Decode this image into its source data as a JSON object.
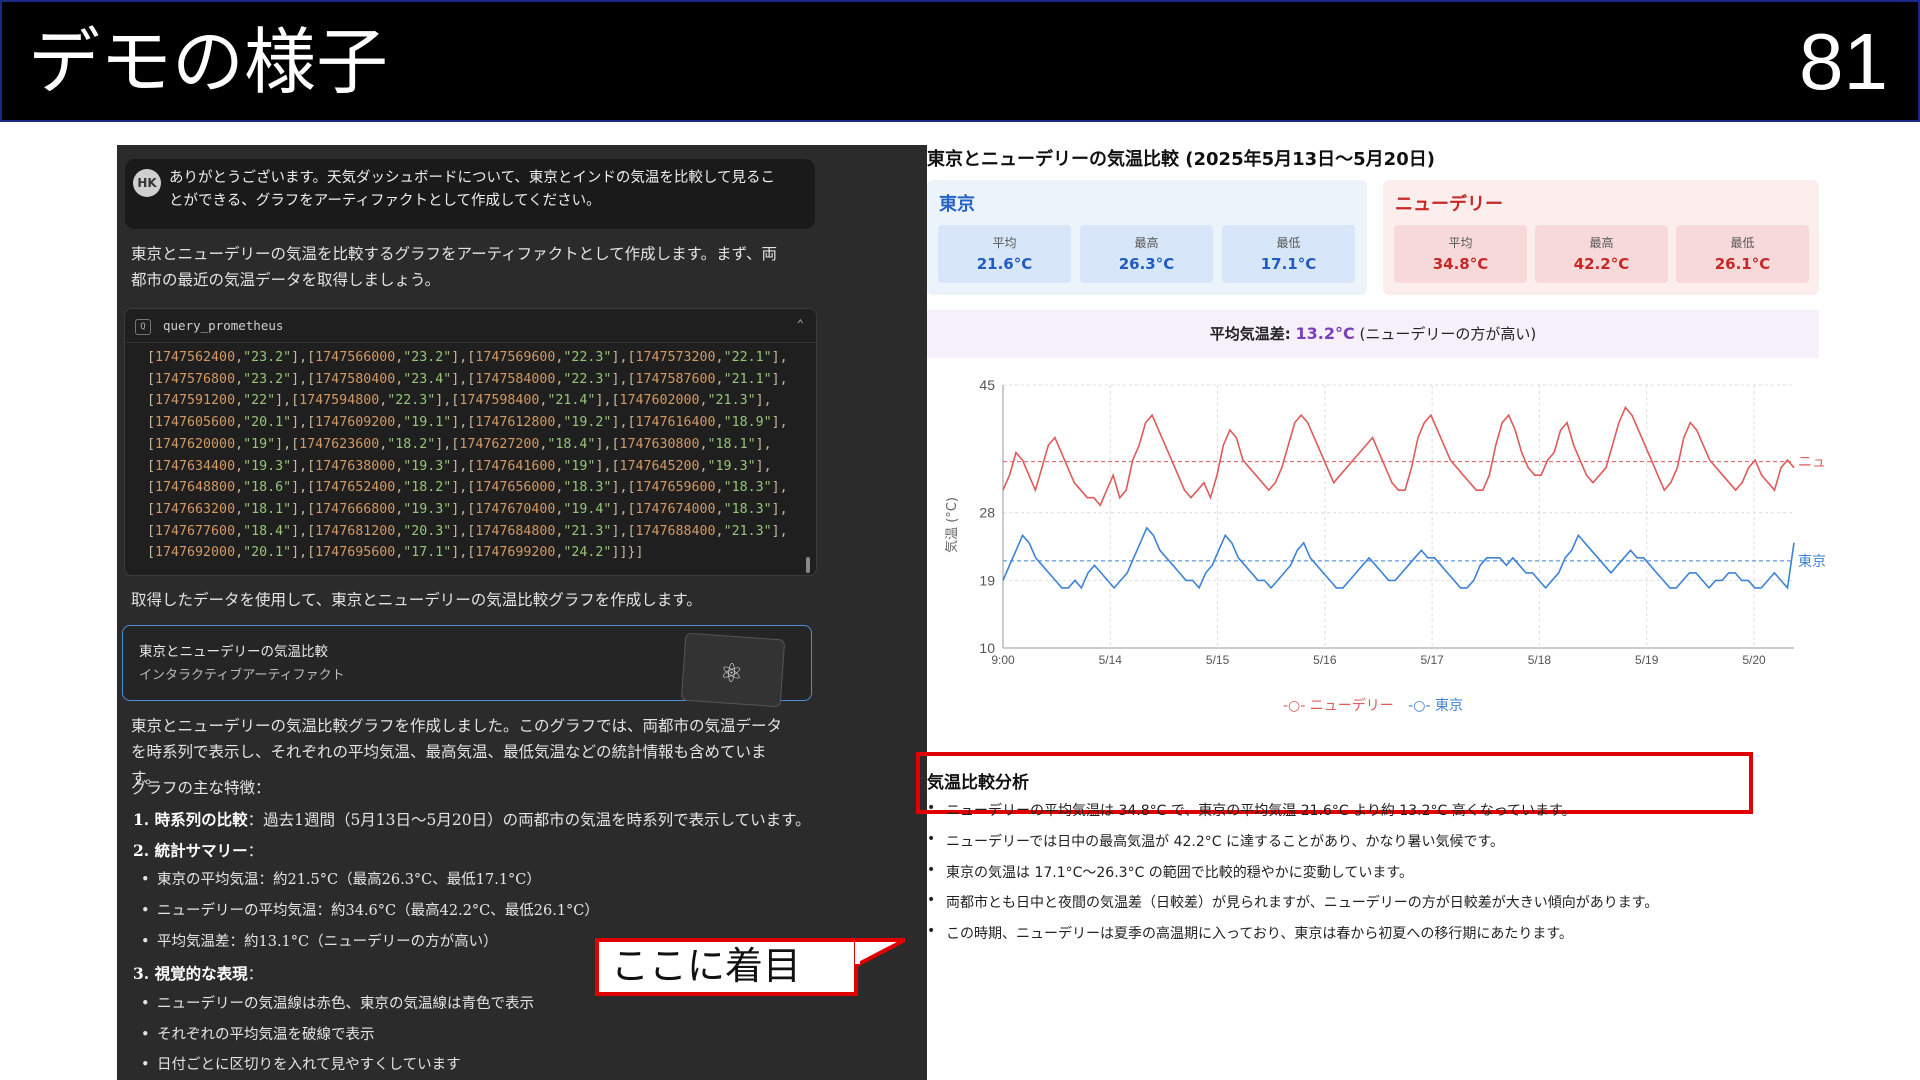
{
  "slide": {
    "title": "デモの様子",
    "page_number": "81"
  },
  "chat": {
    "user_avatar": "HK",
    "user_message": "ありがとうございます。天気ダッシュボードについて、東京とインドの気温を比較して見ることができる、グラフをアーティファクトとして作成してください。",
    "intro": "東京とニューデリーの気温を比較するグラフをアーティファクトとして作成します。まず、両都市の最近の気温データを取得しましょう。",
    "tool": {
      "name": "query_prometheus",
      "lines": [
        "[1747562400,\"23.2\"],[1747566000,\"23.2\"],[1747569600,\"22.3\"],[1747573200,\"22.1\"],",
        "[1747576800,\"23.2\"],[1747580400,\"23.4\"],[1747584000,\"22.3\"],[1747587600,\"21.1\"],",
        "[1747591200,\"22\"],[1747594800,\"22.3\"],[1747598400,\"21.4\"],[1747602000,\"21.3\"],",
        "[1747605600,\"20.1\"],[1747609200,\"19.1\"],[1747612800,\"19.2\"],[1747616400,\"18.9\"],",
        "[1747620000,\"19\"],[1747623600,\"18.2\"],[1747627200,\"18.4\"],[1747630800,\"18.1\"],",
        "[1747634400,\"19.3\"],[1747638000,\"19.3\"],[1747641600,\"19\"],[1747645200,\"19.3\"],",
        "[1747648800,\"18.6\"],[1747652400,\"18.2\"],[1747656000,\"18.3\"],[1747659600,\"18.3\"],",
        "[1747663200,\"18.1\"],[1747666800,\"19.3\"],[1747670400,\"19.4\"],[1747674000,\"18.3\"],",
        "[1747677600,\"18.4\"],[1747681200,\"20.3\"],[1747684800,\"21.3\"],[1747688400,\"21.3\"],",
        "[1747692000,\"20.1\"],[1747695600,\"17.1\"],[1747699200,\"24.2\"]]}]"
      ]
    },
    "after_tool": "取得したデータを使用して、東京とニューデリーの気温比較グラフを作成します。",
    "artifact": {
      "title": "東京とニューデリーの気温比較",
      "subtitle": "インタラクティブアーティファクト"
    },
    "summary": "東京とニューデリーの気温比較グラフを作成しました。このグラフでは、両都市の気温データを時系列で表示し、それぞれの平均気温、最高気温、最低気温などの統計情報も含めています。",
    "features_heading": "グラフの主な特徴：",
    "f1_label": "1. 時系列の比較",
    "f1_text": "：過去1週間（5月13日〜5月20日）の両都市の気温を時系列で表示しています。",
    "f2_label": "2. 統計サマリー",
    "f2_text": "：",
    "f2_items": [
      "東京の平均気温：約21.5°C（最高26.3°C、最低17.1°C）",
      "ニューデリーの平均気温：約34.6°C（最高42.2°C、最低26.1°C）",
      "平均気温差：約13.1°C（ニューデリーの方が高い）"
    ],
    "f3_label": "3. 視覚的な表現",
    "f3_text": "：",
    "f3_items": [
      "ニューデリーの気温線は赤色、東京の気温線は青色で表示",
      "それぞれの平均気温を破線で表示",
      "日付ごとに区切りを入れて見やすくしています"
    ]
  },
  "callout": "ここに着目",
  "dashboard": {
    "title": "東京とニューデリーの気温比較 (2025年5月13日〜5月20日)",
    "tokyo": {
      "name": "東京",
      "avg_label": "平均",
      "avg": "21.6°C",
      "max_label": "最高",
      "max": "26.3°C",
      "min_label": "最低",
      "min": "17.1°C"
    },
    "delhi": {
      "name": "ニューデリー",
      "avg_label": "平均",
      "avg": "34.8°C",
      "max_label": "最高",
      "max": "42.2°C",
      "min_label": "最低",
      "min": "26.1°C"
    },
    "diff_label": "平均気温差:",
    "diff_value": "13.2°C",
    "diff_note": "(ニューデリーの方が高い)",
    "legend_delhi": "ニューデリー",
    "legend_tokyo": "東京",
    "analysis_title": "気温比較分析",
    "analysis": [
      "ニューデリーの平均気温は 34.8°C で、東京の平均気温 21.6°C より約 13.2°C 高くなっています。",
      "ニューデリーでは日中の最高気温が 42.2°C に達することがあり、かなり暑い気候です。",
      "東京の気温は 17.1°C〜26.3°C の範囲で比較的穏やかに変動しています。",
      "両都市とも日中と夜間の気温差（日較差）が見られますが、ニューデリーの方が日較差が大きい傾向があります。",
      "この時期、ニューデリーは夏季の高温期に入っており、東京は春から初夏への移行期にあたります。"
    ]
  },
  "chart_data": {
    "type": "line",
    "ylabel": "気温 (°C)",
    "ylim": [
      10,
      45
    ],
    "yticks": [
      10,
      19,
      28,
      45
    ],
    "xticks": [
      "9:00",
      "5/14",
      "5/15",
      "5/16",
      "5/17",
      "5/18",
      "5/19",
      "5/20"
    ],
    "grid": true,
    "legend": "bottom-center",
    "colors": {
      "delhi": "#e05a5a",
      "tokyo": "#3d82d6"
    },
    "mean_line_labels": [
      "ニュ",
      "東京"
    ],
    "series": [
      {
        "name": "ニューデリー",
        "mean": 34.8,
        "values": [
          31,
          33,
          36,
          35,
          33,
          31,
          34,
          37,
          38,
          36,
          34,
          32,
          31,
          30,
          30,
          29,
          31,
          33,
          30,
          31,
          35,
          37,
          40,
          41,
          39,
          37,
          35,
          33,
          31,
          30,
          31,
          32,
          30,
          33,
          37,
          39,
          38,
          35,
          34,
          33,
          32,
          31,
          32,
          34,
          37,
          40,
          41,
          40,
          38,
          36,
          34,
          32,
          33,
          34,
          35,
          36,
          37,
          38,
          36,
          34,
          32,
          31,
          31,
          34,
          38,
          40,
          41,
          39,
          37,
          35,
          34,
          33,
          32,
          31,
          31,
          33,
          37,
          40,
          41,
          39,
          36,
          34,
          33,
          33,
          35,
          36,
          39,
          40,
          37,
          35,
          33,
          32,
          33,
          34,
          37,
          40,
          42,
          41,
          39,
          37,
          35,
          33,
          31,
          32,
          34,
          38,
          40,
          39,
          37,
          35,
          34,
          33,
          32,
          31,
          32,
          34,
          35,
          33,
          32,
          31,
          34,
          35,
          34
        ]
      },
      {
        "name": "東京",
        "mean": 21.6,
        "values": [
          19,
          21,
          23,
          25,
          24,
          22,
          21,
          20,
          19,
          18,
          18,
          19,
          18,
          20,
          21,
          20,
          19,
          18,
          19,
          20,
          22,
          24,
          26,
          25,
          23,
          22,
          21,
          20,
          19,
          19,
          18,
          20,
          21,
          23,
          25,
          24,
          22,
          21,
          20,
          19,
          19,
          18,
          19,
          20,
          21,
          23,
          24,
          22,
          21,
          20,
          19,
          18,
          18,
          19,
          20,
          21,
          22,
          21,
          20,
          19,
          19,
          20,
          21,
          22,
          23,
          22,
          22,
          21,
          20,
          19,
          18,
          18,
          19,
          21,
          22,
          22,
          22,
          21,
          22,
          21,
          20,
          20,
          19,
          18,
          19,
          20,
          22,
          23,
          25,
          24,
          23,
          22,
          21,
          20,
          21,
          22,
          23,
          22,
          22,
          21,
          20,
          19,
          18,
          18,
          19,
          20,
          20,
          19,
          18,
          19,
          19,
          20,
          20,
          19,
          19,
          18,
          18,
          19,
          20,
          19,
          18,
          24
        ]
      }
    ]
  }
}
